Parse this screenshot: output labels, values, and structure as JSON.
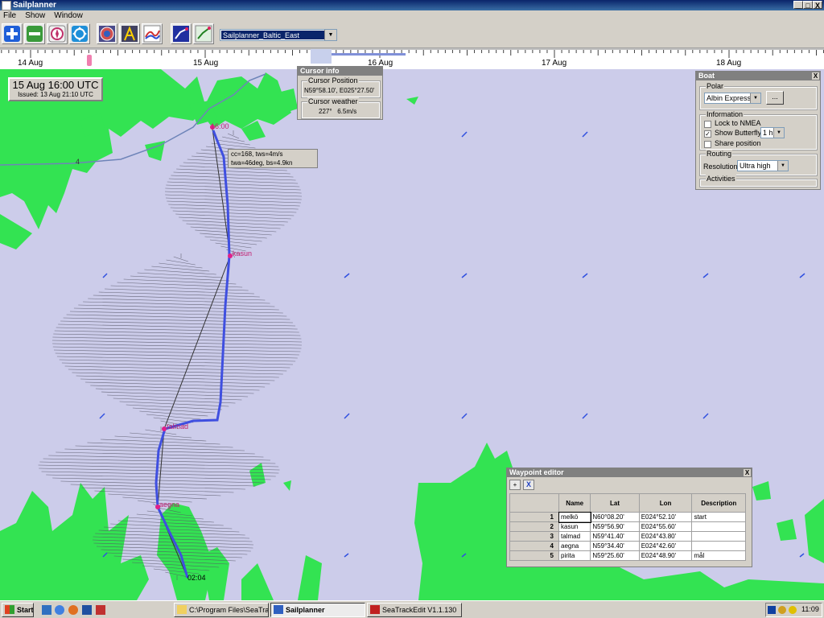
{
  "window": {
    "title": "Sailplanner",
    "buttons": [
      "_",
      "□",
      "X"
    ]
  },
  "menu": [
    "File",
    "Show",
    "Window"
  ],
  "toolbar": {
    "route_select": "Sailplanner_Baltic_East"
  },
  "timeline": {
    "labels": [
      "14 Aug",
      "15 Aug",
      "16 Aug",
      "17 Aug",
      "18 Aug"
    ]
  },
  "forecast": {
    "time": "15 Aug 16:00 UTC",
    "issued": "Issued: 13 Aug 21:10 UTC"
  },
  "cursor_info": {
    "title": "Cursor info",
    "position_label": "Cursor Position",
    "position_value": "N59°58.10', E025°27.50'",
    "weather_label": "Cursor weather",
    "weather_value": "227°   6.5m/s"
  },
  "route_tooltip": {
    "line1": "cc=168,  tws=4m/s",
    "line2": "twa=46deg, bs=4.9kn"
  },
  "map_labels": {
    "time_start": "16:00",
    "time_end": "02:04",
    "depth": "4",
    "wp_kasun": "kasun",
    "wp_talmad": "talmad",
    "wp_aegna": "aegna"
  },
  "boat_panel": {
    "title": "Boat",
    "polar_label": "Polar",
    "polar_value": "Albin Express",
    "polar_button": "...",
    "info_label": "Information",
    "lock_nmea": "Lock to NMEA",
    "lock_nmea_checked": false,
    "show_butterfly": "Show Butterfly",
    "show_butterfly_checked": true,
    "butterfly_interval": "1 h",
    "share_position": "Share position",
    "share_position_checked": false,
    "routing_label": "Routing",
    "resolution_label": "Resolution:",
    "resolution_value": "Ultra high",
    "activities_label": "Activities"
  },
  "waypoint_editor": {
    "title": "Waypoint editor",
    "columns": [
      "Name",
      "Lat",
      "Lon",
      "Description"
    ],
    "rows": [
      {
        "num": "1",
        "name": "melkö",
        "lat": "N60°08.20'",
        "lon": "E024°52.10'",
        "desc": "start"
      },
      {
        "num": "2",
        "name": "kasun",
        "lat": "N59°56.90'",
        "lon": "E024°55.60'",
        "desc": ""
      },
      {
        "num": "3",
        "name": "talmad",
        "lat": "N59°41.40'",
        "lon": "E024°43.80'",
        "desc": ""
      },
      {
        "num": "4",
        "name": "aegna",
        "lat": "N59°34.40'",
        "lon": "E024°42.60'",
        "desc": ""
      },
      {
        "num": "5",
        "name": "pirita",
        "lat": "N59°25.60'",
        "lon": "E024°48.90'",
        "desc": "mål"
      }
    ]
  },
  "taskbar": {
    "start": "Start",
    "tasks": [
      "C:\\Program Files\\SeaTra...",
      "Sailplanner",
      "SeaTrackEdit  V1.1.130"
    ],
    "clock": "11:09"
  },
  "colors": {
    "sea": "#ccccea",
    "land": "#33e352",
    "route": "#3f4fe0",
    "waypoint": "#e0208a"
  }
}
